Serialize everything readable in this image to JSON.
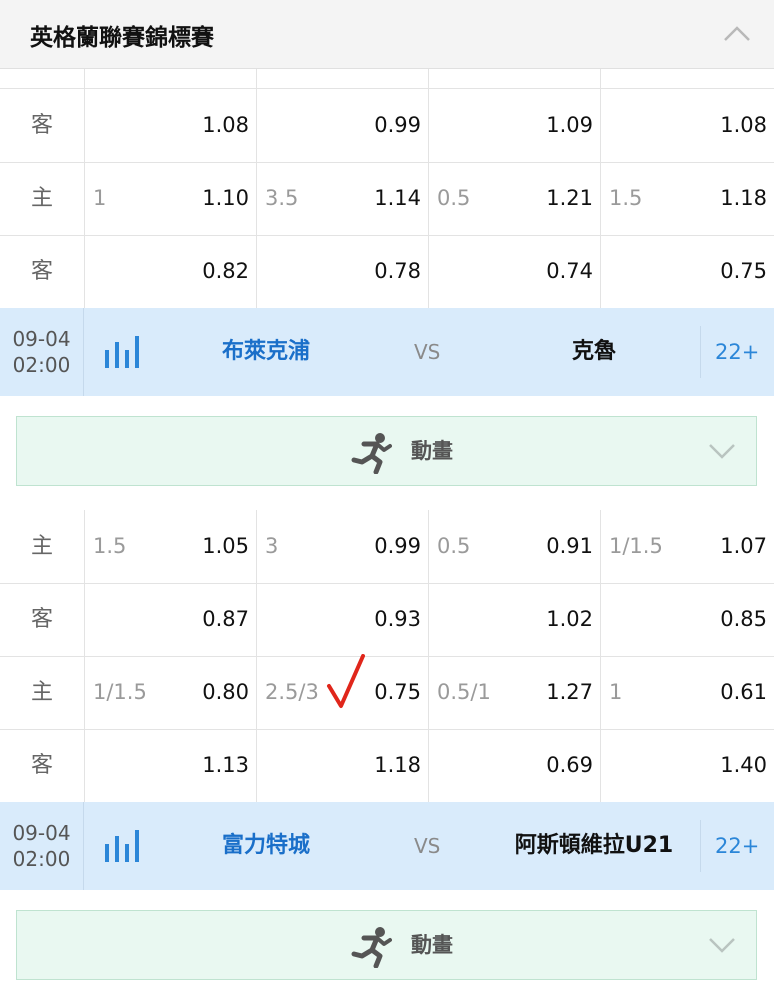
{
  "league": {
    "title": "英格蘭聯賽錦標賽",
    "collapse_icon": "chevron-up-icon"
  },
  "block1": {
    "rows": [
      {
        "label": "客",
        "cells": [
          {
            "h": "",
            "o": "1.08"
          },
          {
            "h": "",
            "o": "0.99"
          },
          {
            "h": "",
            "o": "1.09"
          },
          {
            "h": "",
            "o": "1.08"
          }
        ]
      },
      {
        "label": "主",
        "cells": [
          {
            "h": "1",
            "o": "1.10"
          },
          {
            "h": "3.5",
            "o": "1.14"
          },
          {
            "h": "0.5",
            "o": "1.21"
          },
          {
            "h": "1.5",
            "o": "1.18"
          }
        ]
      },
      {
        "label": "客",
        "cells": [
          {
            "h": "",
            "o": "0.82"
          },
          {
            "h": "",
            "o": "0.78"
          },
          {
            "h": "",
            "o": "0.74"
          },
          {
            "h": "",
            "o": "0.75"
          }
        ]
      }
    ]
  },
  "match1": {
    "date": "09-04",
    "time": "02:00",
    "home": "布萊克浦",
    "vs": "VS",
    "away": "克魯",
    "more": "22+",
    "stats_icon": "bar-chart-icon"
  },
  "anim1": {
    "label": "動畫",
    "icon": "running-man-icon",
    "expand_icon": "chevron-down-icon"
  },
  "block2": {
    "rows": [
      {
        "label": "主",
        "cells": [
          {
            "h": "1.5",
            "o": "1.05"
          },
          {
            "h": "3",
            "o": "0.99"
          },
          {
            "h": "0.5",
            "o": "0.91"
          },
          {
            "h": "1/1.5",
            "o": "1.07"
          }
        ]
      },
      {
        "label": "客",
        "cells": [
          {
            "h": "",
            "o": "0.87"
          },
          {
            "h": "",
            "o": "0.93"
          },
          {
            "h": "",
            "o": "1.02"
          },
          {
            "h": "",
            "o": "0.85"
          }
        ]
      },
      {
        "label": "主",
        "cells": [
          {
            "h": "1/1.5",
            "o": "0.80"
          },
          {
            "h": "2.5/3",
            "o": "0.75"
          },
          {
            "h": "0.5/1",
            "o": "1.27"
          },
          {
            "h": "1",
            "o": "0.61"
          }
        ]
      },
      {
        "label": "客",
        "cells": [
          {
            "h": "",
            "o": "1.13"
          },
          {
            "h": "",
            "o": "1.18"
          },
          {
            "h": "",
            "o": "0.69"
          },
          {
            "h": "",
            "o": "1.40"
          }
        ]
      }
    ]
  },
  "match2": {
    "date": "09-04",
    "time": "02:00",
    "home": "富力特城",
    "vs": "VS",
    "away": "阿斯頓維拉U21",
    "more": "22+",
    "stats_icon": "bar-chart-icon"
  },
  "anim2": {
    "label": "動畫",
    "icon": "running-man-icon",
    "expand_icon": "chevron-down-icon"
  },
  "annotation": {
    "icon": "red-check-mark-icon",
    "color": "#e0261b"
  }
}
